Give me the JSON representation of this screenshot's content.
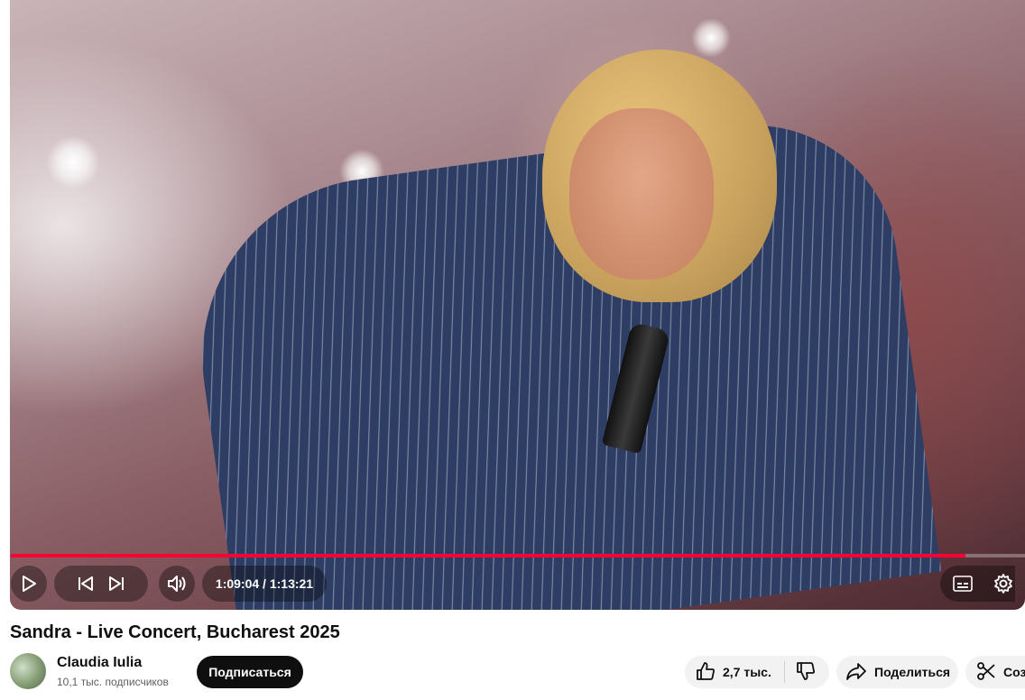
{
  "player": {
    "time_display": "1:09:04 / 1:13:21",
    "progress": 0.941,
    "accent_color": "#ff0033",
    "controls": [
      "play-icon",
      "previous-icon",
      "next-icon",
      "volume-icon",
      "subtitles-icon",
      "settings-icon"
    ]
  },
  "video": {
    "title": "Sandra - Live Concert, Bucharest 2025"
  },
  "channel": {
    "name": "Claudia Iulia",
    "subscribers": "10,1 тыс. подписчиков",
    "subscribe_label": "Подписаться"
  },
  "actions": {
    "likes": "2,7 тыс.",
    "share_label": "Поделиться",
    "clip_label": "Созд"
  }
}
